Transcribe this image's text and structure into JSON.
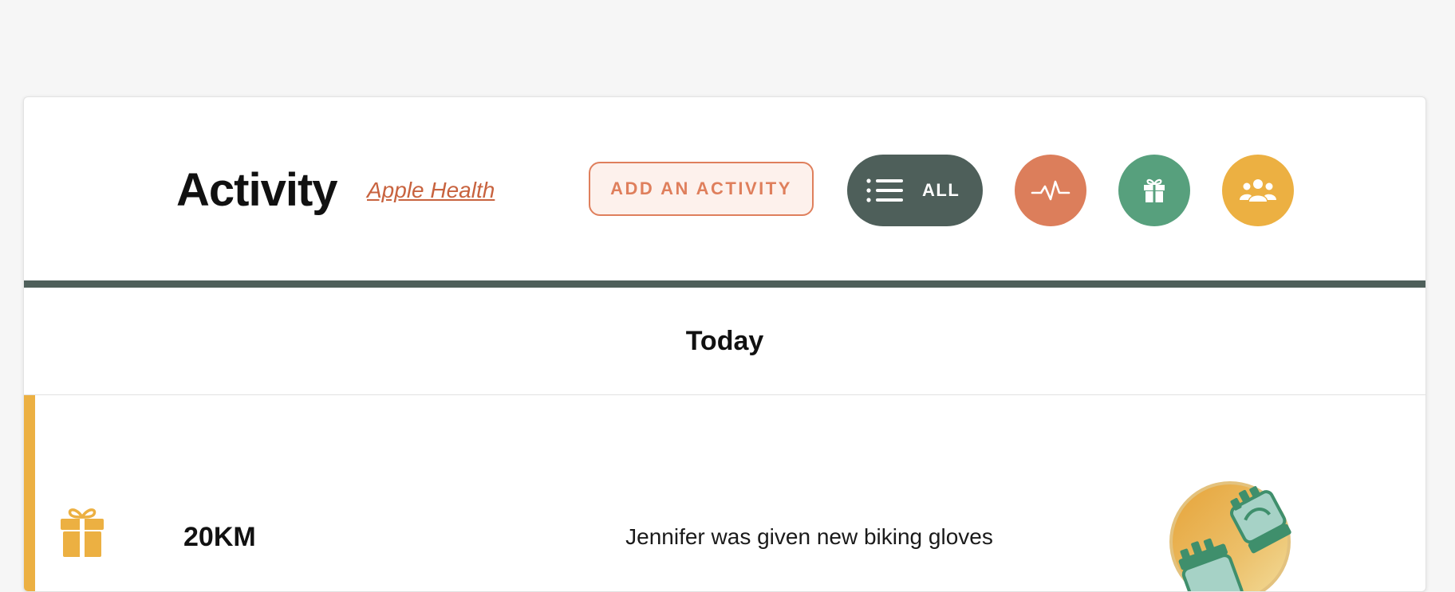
{
  "header": {
    "title": "Activity",
    "source_link": "Apple Health",
    "add_button_label": "ADD AN ACTIVITY",
    "filters": [
      {
        "id": "all",
        "label": "ALL",
        "icon": "list-icon",
        "color": "#4e5f5a",
        "selected": true
      },
      {
        "id": "activity",
        "icon": "heartbeat-icon",
        "color": "#dc7e5b"
      },
      {
        "id": "rewards",
        "icon": "gift-icon",
        "color": "#57a07d"
      },
      {
        "id": "social",
        "icon": "group-icon",
        "color": "#ecb042"
      }
    ]
  },
  "feed": {
    "day_label": "Today",
    "items": [
      {
        "type": "reward",
        "icon": "gift-icon",
        "accent_color": "#ecb042",
        "value": "20KM",
        "description": "Jennifer was given new biking gloves",
        "badge": "biking-gloves-badge"
      }
    ]
  }
}
